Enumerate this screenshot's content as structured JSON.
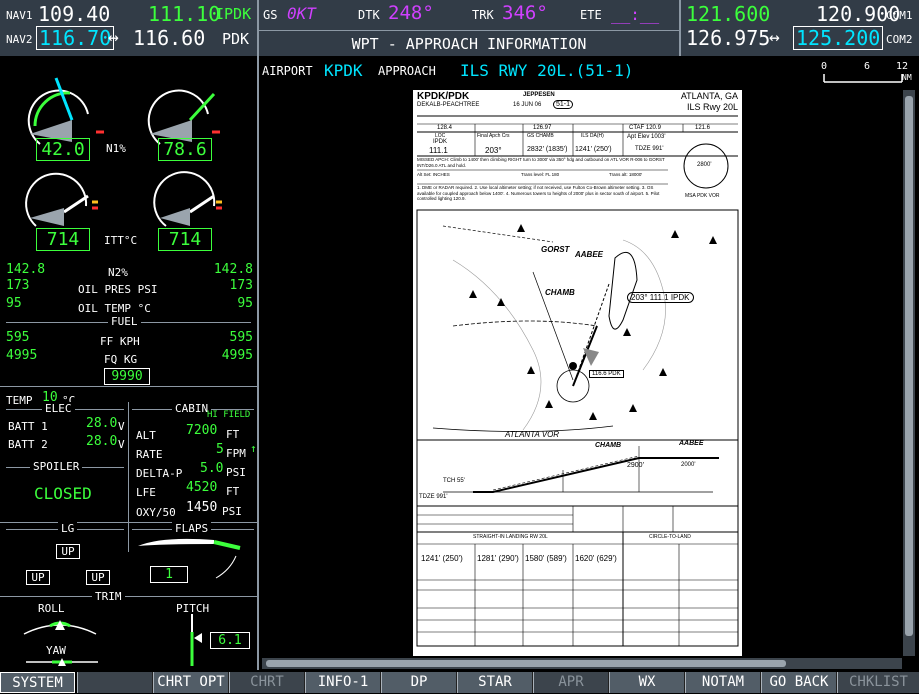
{
  "nav": {
    "nav1_label": "NAV1",
    "nav1_standby": "109.40",
    "nav1_active": "111.10",
    "nav1_ident": "IPDK",
    "nav2_label": "NAV2",
    "nav2_standby": "116.70",
    "nav2_arrow": "↔",
    "nav2_active": "116.60",
    "nav2_ident": "PDK"
  },
  "data_bar": {
    "gs_label": "GS",
    "gs_value": "0KT",
    "dtk_label": "DTK",
    "dtk_value": "248°",
    "trk_label": "TRK",
    "trk_value": "346°",
    "ete_label": "ETE",
    "ete_value": "__:__",
    "page_title": "WPT - APPROACH INFORMATION"
  },
  "com": {
    "com1_active": "121.600",
    "com1_standby": "120.900",
    "com1_label": "COM1",
    "com2_active": "126.975",
    "com2_arrow": "↔",
    "com2_standby": "125.200",
    "com2_label": "COM2"
  },
  "scale": {
    "t0": "0",
    "t6": "6",
    "t12": "12",
    "unit": "NM"
  },
  "airport_bar": {
    "airport_label": "AIRPORT",
    "airport_value": "KPDK",
    "approach_label": "APPROACH",
    "approach_value": "ILS RWY 20L.(51-1)"
  },
  "engine": {
    "n1_label": "N1%",
    "n1_left": "42.0",
    "n1_right": "78.6",
    "itt_label": "ITT°C",
    "itt_left": "714",
    "itt_right": "714",
    "n2_label": "N2%",
    "n2_left": "142.8",
    "n2_right": "142.8",
    "oilp_label": "OIL PRES PSI",
    "oilp_left": "173",
    "oilp_right": "173",
    "oilt_label": "OIL TEMP °C",
    "oilt_left": "95",
    "oilt_right": "95",
    "fuel_title": "FUEL",
    "ff_label": "FF KPH",
    "ff_left": "595",
    "ff_right": "595",
    "fq_label": "FQ KG",
    "fq_left": "4995",
    "fq_right": "4995",
    "fq_total": "9990"
  },
  "systems": {
    "temp_label": "TEMP",
    "temp_value": "10",
    "temp_unit": "°C",
    "elec_title": "ELEC",
    "batt1_label": "BATT 1",
    "batt1_value": "28.0",
    "batt2_label": "BATT 2",
    "batt2_value": "28.0",
    "volt_unit": "V",
    "cabin_title": "CABIN",
    "hi_field": "HI FIELD",
    "alt_label": "ALT",
    "alt_value": "7200",
    "alt_unit": "FT",
    "rate_label": "RATE",
    "rate_value": "5",
    "rate_unit": "FPM",
    "deltap_label": "DELTA-P",
    "deltap_value": "5.0",
    "deltap_unit": "PSI",
    "lfe_label": "LFE",
    "lfe_value": "4520",
    "lfe_unit": "FT",
    "oxy_label": "OXY/50",
    "oxy_value": "1450",
    "oxy_unit": "PSI",
    "spoiler_title": "SPOILER",
    "spoiler_value": "CLOSED",
    "lg_title": "LG",
    "lg_nose": "UP",
    "lg_left": "UP",
    "lg_right": "UP",
    "flaps_title": "FLAPS",
    "flaps_value": "1",
    "trim_title": "TRIM",
    "roll_label": "ROLL",
    "pitch_label": "PITCH",
    "pitch_value": "6.1",
    "yaw_label": "YAW"
  },
  "chart": {
    "airport_ident": "KPDK/PDK",
    "airport_name": "DEKALB-PEACHTREE",
    "brand": "JEPPESEN",
    "date": "16 JUN 06",
    "index": "51-1",
    "city": "ATLANTA, GA",
    "procedure": "ILS Rwy 20L",
    "freq1": "128.4",
    "freq2": "126.97",
    "freq3": "CTAF 120.9",
    "freq4": "121.6",
    "loc_label": "LOC",
    "loc_ident": "IPDK",
    "loc_freq": "111.1",
    "crs_label": "Final Apch Crs",
    "crs_value": "203°",
    "gs_label": "GS CHAMB",
    "gs_value": "2832' (1835')",
    "da_label": "ILS DA(H)",
    "da_value": "1241' (250')",
    "apt_elev": "Apt Elev 1003'",
    "tdze": "TDZE 991'",
    "msa": "2800'",
    "msa_label": "MSA PDK VOR",
    "missed": "MISSED APCH: Climb to 1400' then climbing RIGHT turn to 3000' via 350° hdg and outbound on ATL VOR R-006 to GORST INT/D26.0 ATL and hold.",
    "alt_set": "Alt Set: INCHES",
    "trans_level": "Trans level: FL 180",
    "trans_alt": "Trans alt: 18000'",
    "notes": "1. DME or RADAR required. 2. Use local altimeter setting; if not received, use Fulton Co-Brown altimeter setting. 3. OS available for coupled approach below 1400'. 4. Numerous towers to heights of 2000' plus in sector south of airport. 5. Pilot controlled lighting 120.9.",
    "fix_gorst": "GORST",
    "fix_aabee": "AABEE",
    "fix_chamb": "CHAMB",
    "loc_box": "203° 111.1 IPDK",
    "vor_box": "116.6 PDK",
    "atlanta_vor": "ATLANTA VOR",
    "profile_chamb": "CHAMB",
    "profile_aabee": "AABEE",
    "profile_alt1": "2900'",
    "profile_alt2": "2000'",
    "profile_tch": "TCH 55'",
    "profile_tdze": "TDZE 991'",
    "straight_in": "STRAIGHT-IN LANDING RW 20L",
    "circle": "CIRCLE-TO-LAND",
    "mins1": "1241' (250')",
    "mins2": "1281' (290')",
    "mins3": "1580' (589')",
    "mins4": "1620' (629')"
  },
  "softkeys": [
    "SYSTEM",
    "",
    "CHRT OPT",
    "CHRT",
    "INFO-1",
    "DP",
    "STAR",
    "APR",
    "WX",
    "NOTAM",
    "GO BACK",
    "CHKLIST"
  ],
  "colors": {
    "cyan": "#00e5ff",
    "magenta": "#d040ff",
    "green": "#3cff3c",
    "header_bg": "#323c47"
  }
}
